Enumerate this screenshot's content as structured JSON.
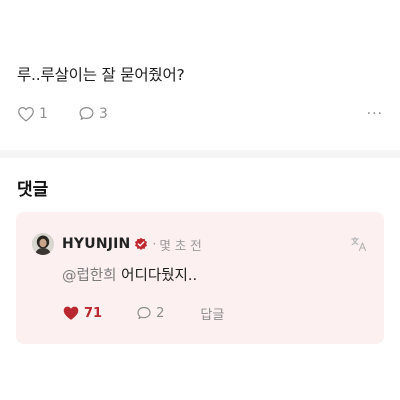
{
  "post": {
    "text": "루..루살이는 잘 묻어줬어?",
    "like_count": "1",
    "reply_count": "3",
    "more_label": "···"
  },
  "comments": {
    "heading": "댓글",
    "items": [
      {
        "author": "HYUNJIN",
        "verified": true,
        "separator": "·",
        "time": "몇 초 전",
        "mention": "@럽한희",
        "text": " 어디다뒀지..",
        "like_count": "71",
        "reply_count": "2",
        "reply_label": "답글"
      }
    ]
  },
  "colors": {
    "heart_liked": "#b8282e",
    "card_bg": "#fcf0f0",
    "verified_badge": "#c0282f",
    "muted": "#8e8e8e"
  },
  "icons": [
    "heart-outline-icon",
    "speech-bubble-icon",
    "more-icon",
    "verified-badge-icon",
    "translate-icon",
    "heart-filled-icon"
  ]
}
